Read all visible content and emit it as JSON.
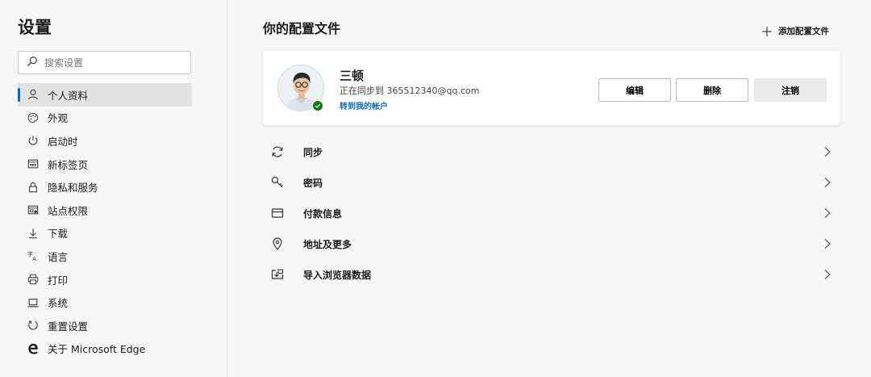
{
  "sidebar": {
    "title": "设置",
    "search_placeholder": "搜索设置",
    "items": [
      {
        "label": "个人资料",
        "icon": "person-icon"
      },
      {
        "label": "外观",
        "icon": "palette-icon"
      },
      {
        "label": "启动时",
        "icon": "power-icon"
      },
      {
        "label": "新标签页",
        "icon": "new-tab-icon"
      },
      {
        "label": "隐私和服务",
        "icon": "lock-icon"
      },
      {
        "label": "站点权限",
        "icon": "site-permissions-icon"
      },
      {
        "label": "下载",
        "icon": "download-icon"
      },
      {
        "label": "语言",
        "icon": "language-icon"
      },
      {
        "label": "打印",
        "icon": "printer-icon"
      },
      {
        "label": "系统",
        "icon": "laptop-icon"
      },
      {
        "label": "重置设置",
        "icon": "reset-icon"
      },
      {
        "label": "关于 Microsoft Edge",
        "icon": "edge-logo-icon"
      }
    ],
    "active_index": 0
  },
  "main": {
    "title": "你的配置文件",
    "add_profile_label": "添加配置文件"
  },
  "profile": {
    "name": "三顿",
    "sync_status": "正在同步到 365512340@qq.com",
    "account_link": "转到我的帐户",
    "edit_label": "编辑",
    "delete_label": "删除",
    "signout_label": "注销"
  },
  "settings": [
    {
      "label": "同步",
      "icon": "sync-icon"
    },
    {
      "label": "密码",
      "icon": "key-icon"
    },
    {
      "label": "付款信息",
      "icon": "credit-card-icon"
    },
    {
      "label": "地址及更多",
      "icon": "location-pin-icon"
    },
    {
      "label": "导入浏览器数据",
      "icon": "import-icon"
    }
  ],
  "colors": {
    "accent": "#0f6cbd",
    "sync_badge": "#107c10"
  }
}
